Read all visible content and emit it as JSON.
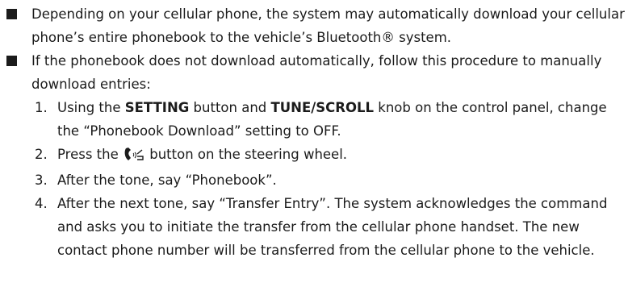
{
  "bullets": [
    {
      "text": "Depending on your cellular phone, the system may automatically download your cellular phone’s entire phonebook to the vehicle’s Bluetooth® system."
    },
    {
      "text": "If the phonebook does not download automatically, follow this procedure to manually download entries:"
    }
  ],
  "steps": [
    {
      "number": "1.",
      "part1": "Using the ",
      "bold1": "SETTING",
      "part2": " button and ",
      "bold2": "TUNE/SCROLL",
      "part3": " knob on the control panel, change the “Phonebook Download” setting to OFF."
    },
    {
      "number": "2.",
      "before_icon": "Press the ",
      "icon": "phone-voice-icon",
      "after_icon": " button on the steering wheel."
    },
    {
      "number": "3.",
      "text": "After the tone, say “Phonebook”."
    },
    {
      "number": "4.",
      "text": "After the next tone, say “Transfer Entry”. The system acknowledges the command and asks you to initiate the transfer from the cellular phone handset. The new contact phone number will be transferred from the cellular phone to the vehicle."
    }
  ]
}
